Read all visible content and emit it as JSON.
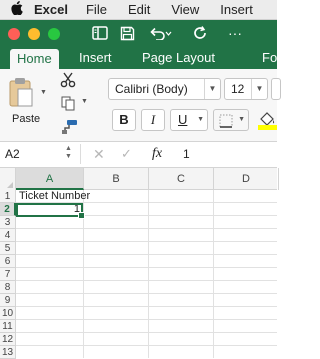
{
  "menubar": {
    "app_name": "Excel",
    "items": [
      "File",
      "Edit",
      "View",
      "Insert"
    ]
  },
  "quick_access": {
    "icons": [
      "sidebar-toggle-icon",
      "save-icon",
      "undo-icon",
      "redo-icon"
    ]
  },
  "ribbon_tabs": [
    "Home",
    "Insert",
    "Page Layout",
    "Fo"
  ],
  "ribbon": {
    "paste_label": "Paste",
    "font_name": "Calibri (Body)",
    "font_size": "12",
    "bold": "B",
    "italic": "I",
    "underline": "U"
  },
  "formula_bar": {
    "name_box": "A2",
    "fx": "fx",
    "value": "1"
  },
  "sheet": {
    "columns": [
      "A",
      "B",
      "C",
      "D"
    ],
    "rows": [
      "1",
      "2",
      "3",
      "4",
      "5",
      "6",
      "7",
      "8",
      "9",
      "10",
      "11",
      "12",
      "13"
    ],
    "selected_cell": "A2",
    "cells": {
      "A1": "Ticket Number",
      "A2": "1"
    }
  },
  "colors": {
    "excel_green": "#217346",
    "close": "#fe5f57",
    "minimize": "#febc2e",
    "zoom": "#28c840"
  }
}
